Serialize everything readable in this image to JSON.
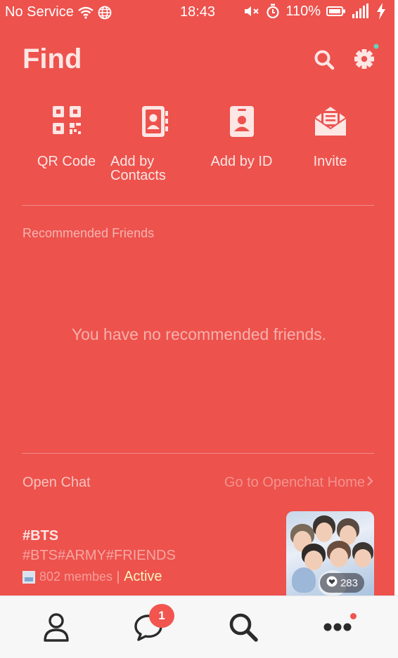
{
  "status_bar": {
    "carrier": "No Service",
    "time": "18:43",
    "battery": "110%",
    "icons": [
      "wifi-icon",
      "globe-icon",
      "mute-icon",
      "alarm-icon",
      "battery-icon",
      "signal-icon",
      "charging-icon"
    ]
  },
  "header": {
    "title": "Find",
    "icons": [
      "search-icon",
      "settings-icon"
    ]
  },
  "actions": [
    {
      "label": "QR Code",
      "icon": "qr-code-icon"
    },
    {
      "label": "Add by\nContacts",
      "icon": "contacts-book-icon"
    },
    {
      "label": "Add by ID",
      "icon": "id-card-icon"
    },
    {
      "label": "Invite",
      "icon": "mail-invite-icon"
    }
  ],
  "recommended": {
    "label": "Recommended Friends",
    "empty_message": "You have no recommended friends."
  },
  "open_chat": {
    "title": "Open Chat",
    "home_link": "Go to Openchat Home",
    "room": {
      "name": "#BTS",
      "tags": "#BTS#ARMY#FRIENDS",
      "members": "802 membes",
      "status": "Active",
      "likes": "283"
    }
  },
  "nav": {
    "items": [
      "friends-icon",
      "chats-icon",
      "find-icon",
      "more-icon"
    ],
    "chat_badge": "1"
  },
  "colors": {
    "background": "#ed524d",
    "nav_background": "#f7f7f7",
    "badge": "#f2554f",
    "active_text": "#fff2b8"
  }
}
